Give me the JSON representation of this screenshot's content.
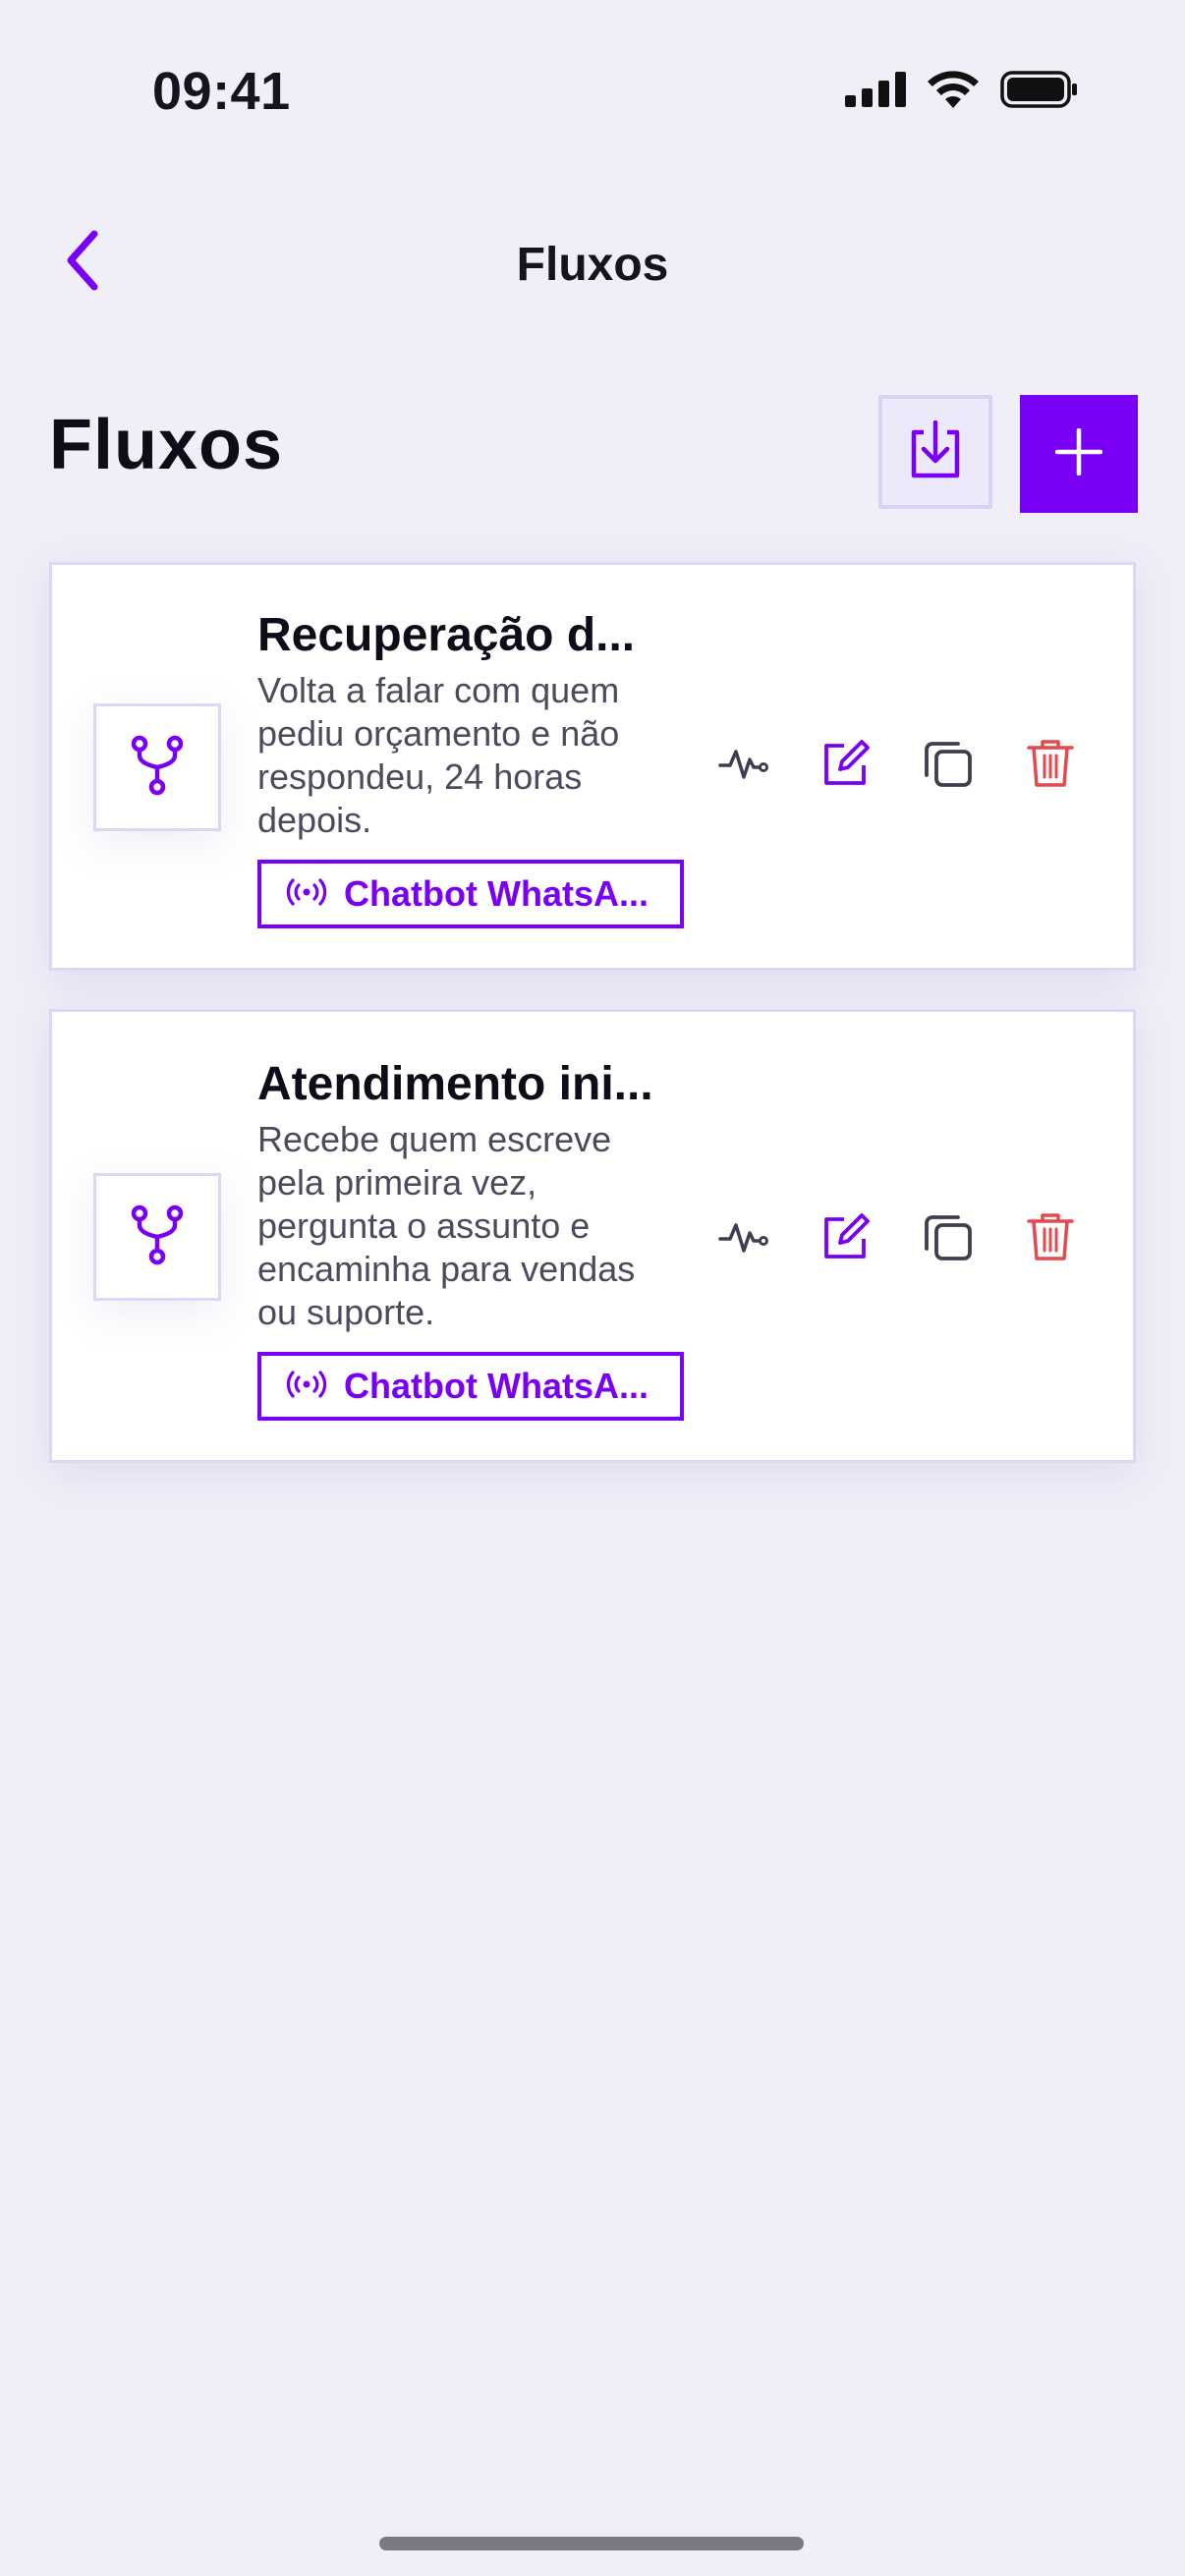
{
  "status_bar": {
    "time": "09:41",
    "icons": [
      "cellular-signal-icon",
      "wifi-icon",
      "battery-icon"
    ]
  },
  "nav": {
    "title": "Fluxos",
    "back_icon": "chevron-left-icon"
  },
  "header": {
    "title": "Fluxos",
    "import_icon": "download-icon",
    "add_icon": "plus-icon"
  },
  "flows": [
    {
      "title": "Recuperação d...",
      "description": "Volta a falar com quem pediu orçamento e não respondeu, 24 horas depois.",
      "channel": "Chatbot WhatsA...",
      "icon": "flow-branch-icon"
    },
    {
      "title": "Atendimento ini...",
      "description": "Recebe quem escreve pela primeira vez, pergunta o assunto e encaminha para vendas ou suporte.",
      "channel": "Chatbot WhatsA...",
      "icon": "flow-branch-icon"
    }
  ],
  "colors": {
    "accent": "#7a00f5",
    "background": "#f0eff8",
    "danger": "#e5484d",
    "border": "#dcd7f5"
  }
}
